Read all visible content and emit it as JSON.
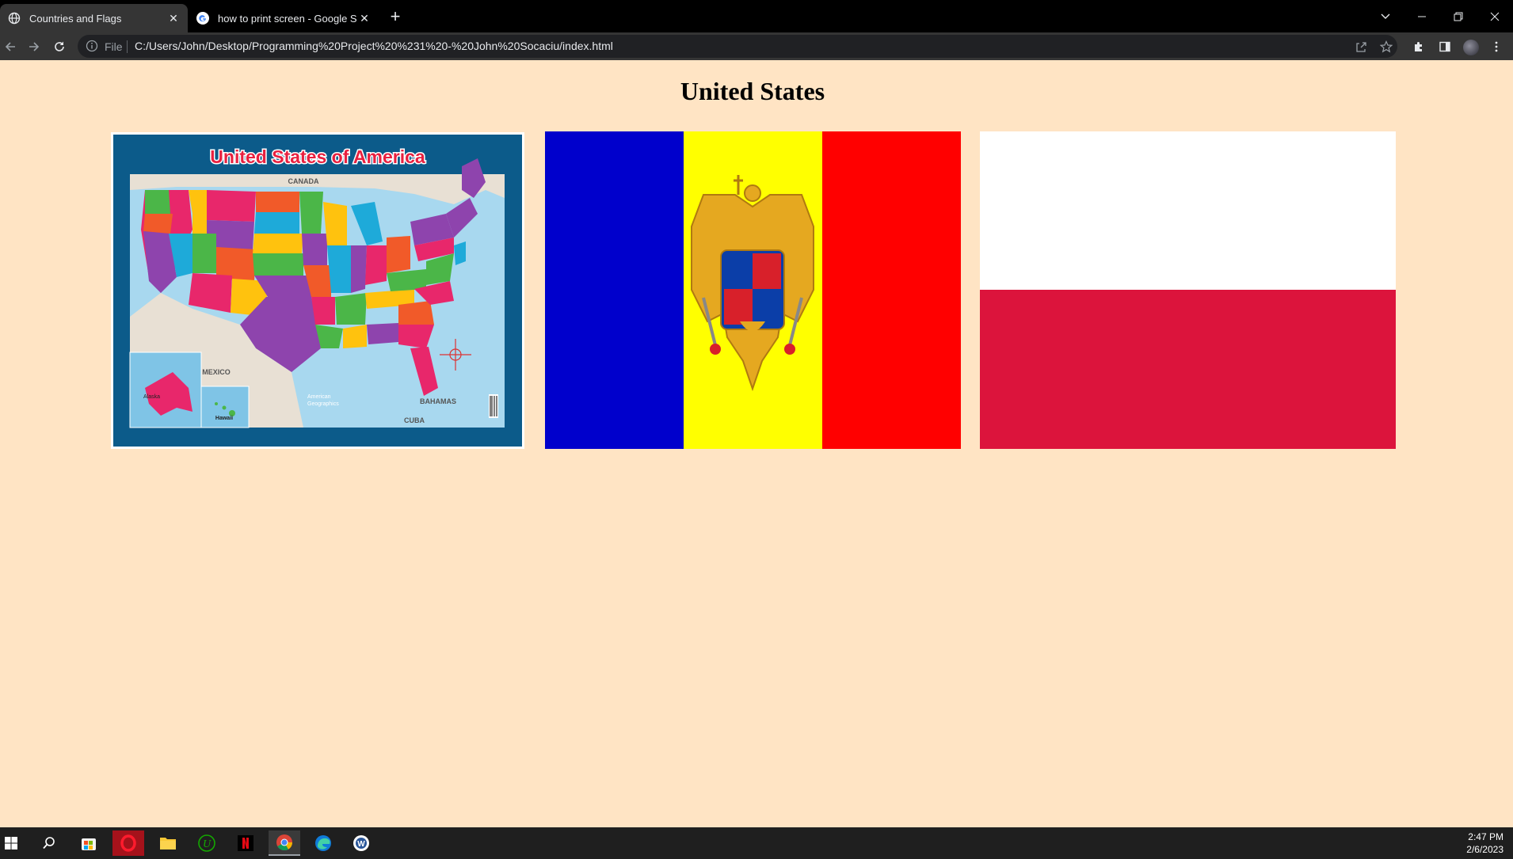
{
  "tabs": [
    {
      "title": "Countries and Flags",
      "active": true
    },
    {
      "title": "how to print screen - Google Sea",
      "active": false
    }
  ],
  "toolbar": {
    "protocol_label": "File",
    "url": "C:/Users/John/Desktop/Programming%20Project%20%231%20-%20John%20Socaciu/index.html"
  },
  "page": {
    "heading": "United States",
    "images": [
      {
        "name": "us-map",
        "title": "United States of America",
        "labels": {
          "canada": "CANADA",
          "mexico": "MEXICO",
          "bahamas": "BAHAMAS",
          "cuba": "CUBA",
          "alaska": "Alaska",
          "hawaii": "Hawaii",
          "brand_1": "American",
          "brand_2": "Geographics"
        }
      },
      {
        "name": "romania-flag",
        "colors": [
          "#0000cc",
          "#ffff00",
          "#ff0000"
        ]
      },
      {
        "name": "poland-flag",
        "colors": [
          "#ffffff",
          "#dc143c"
        ]
      }
    ]
  },
  "taskbar": {
    "apps": [
      "windows-start",
      "search",
      "microsoft-store",
      "opera",
      "file-explorer",
      "upwork",
      "netflix",
      "chrome",
      "edge",
      "word"
    ],
    "time": "2:47 PM",
    "date": "2/6/2023"
  },
  "colors": {
    "page_bg": "#ffe4c4",
    "chrome_dark": "#353535",
    "taskbar_bg": "#1f1f1f"
  }
}
